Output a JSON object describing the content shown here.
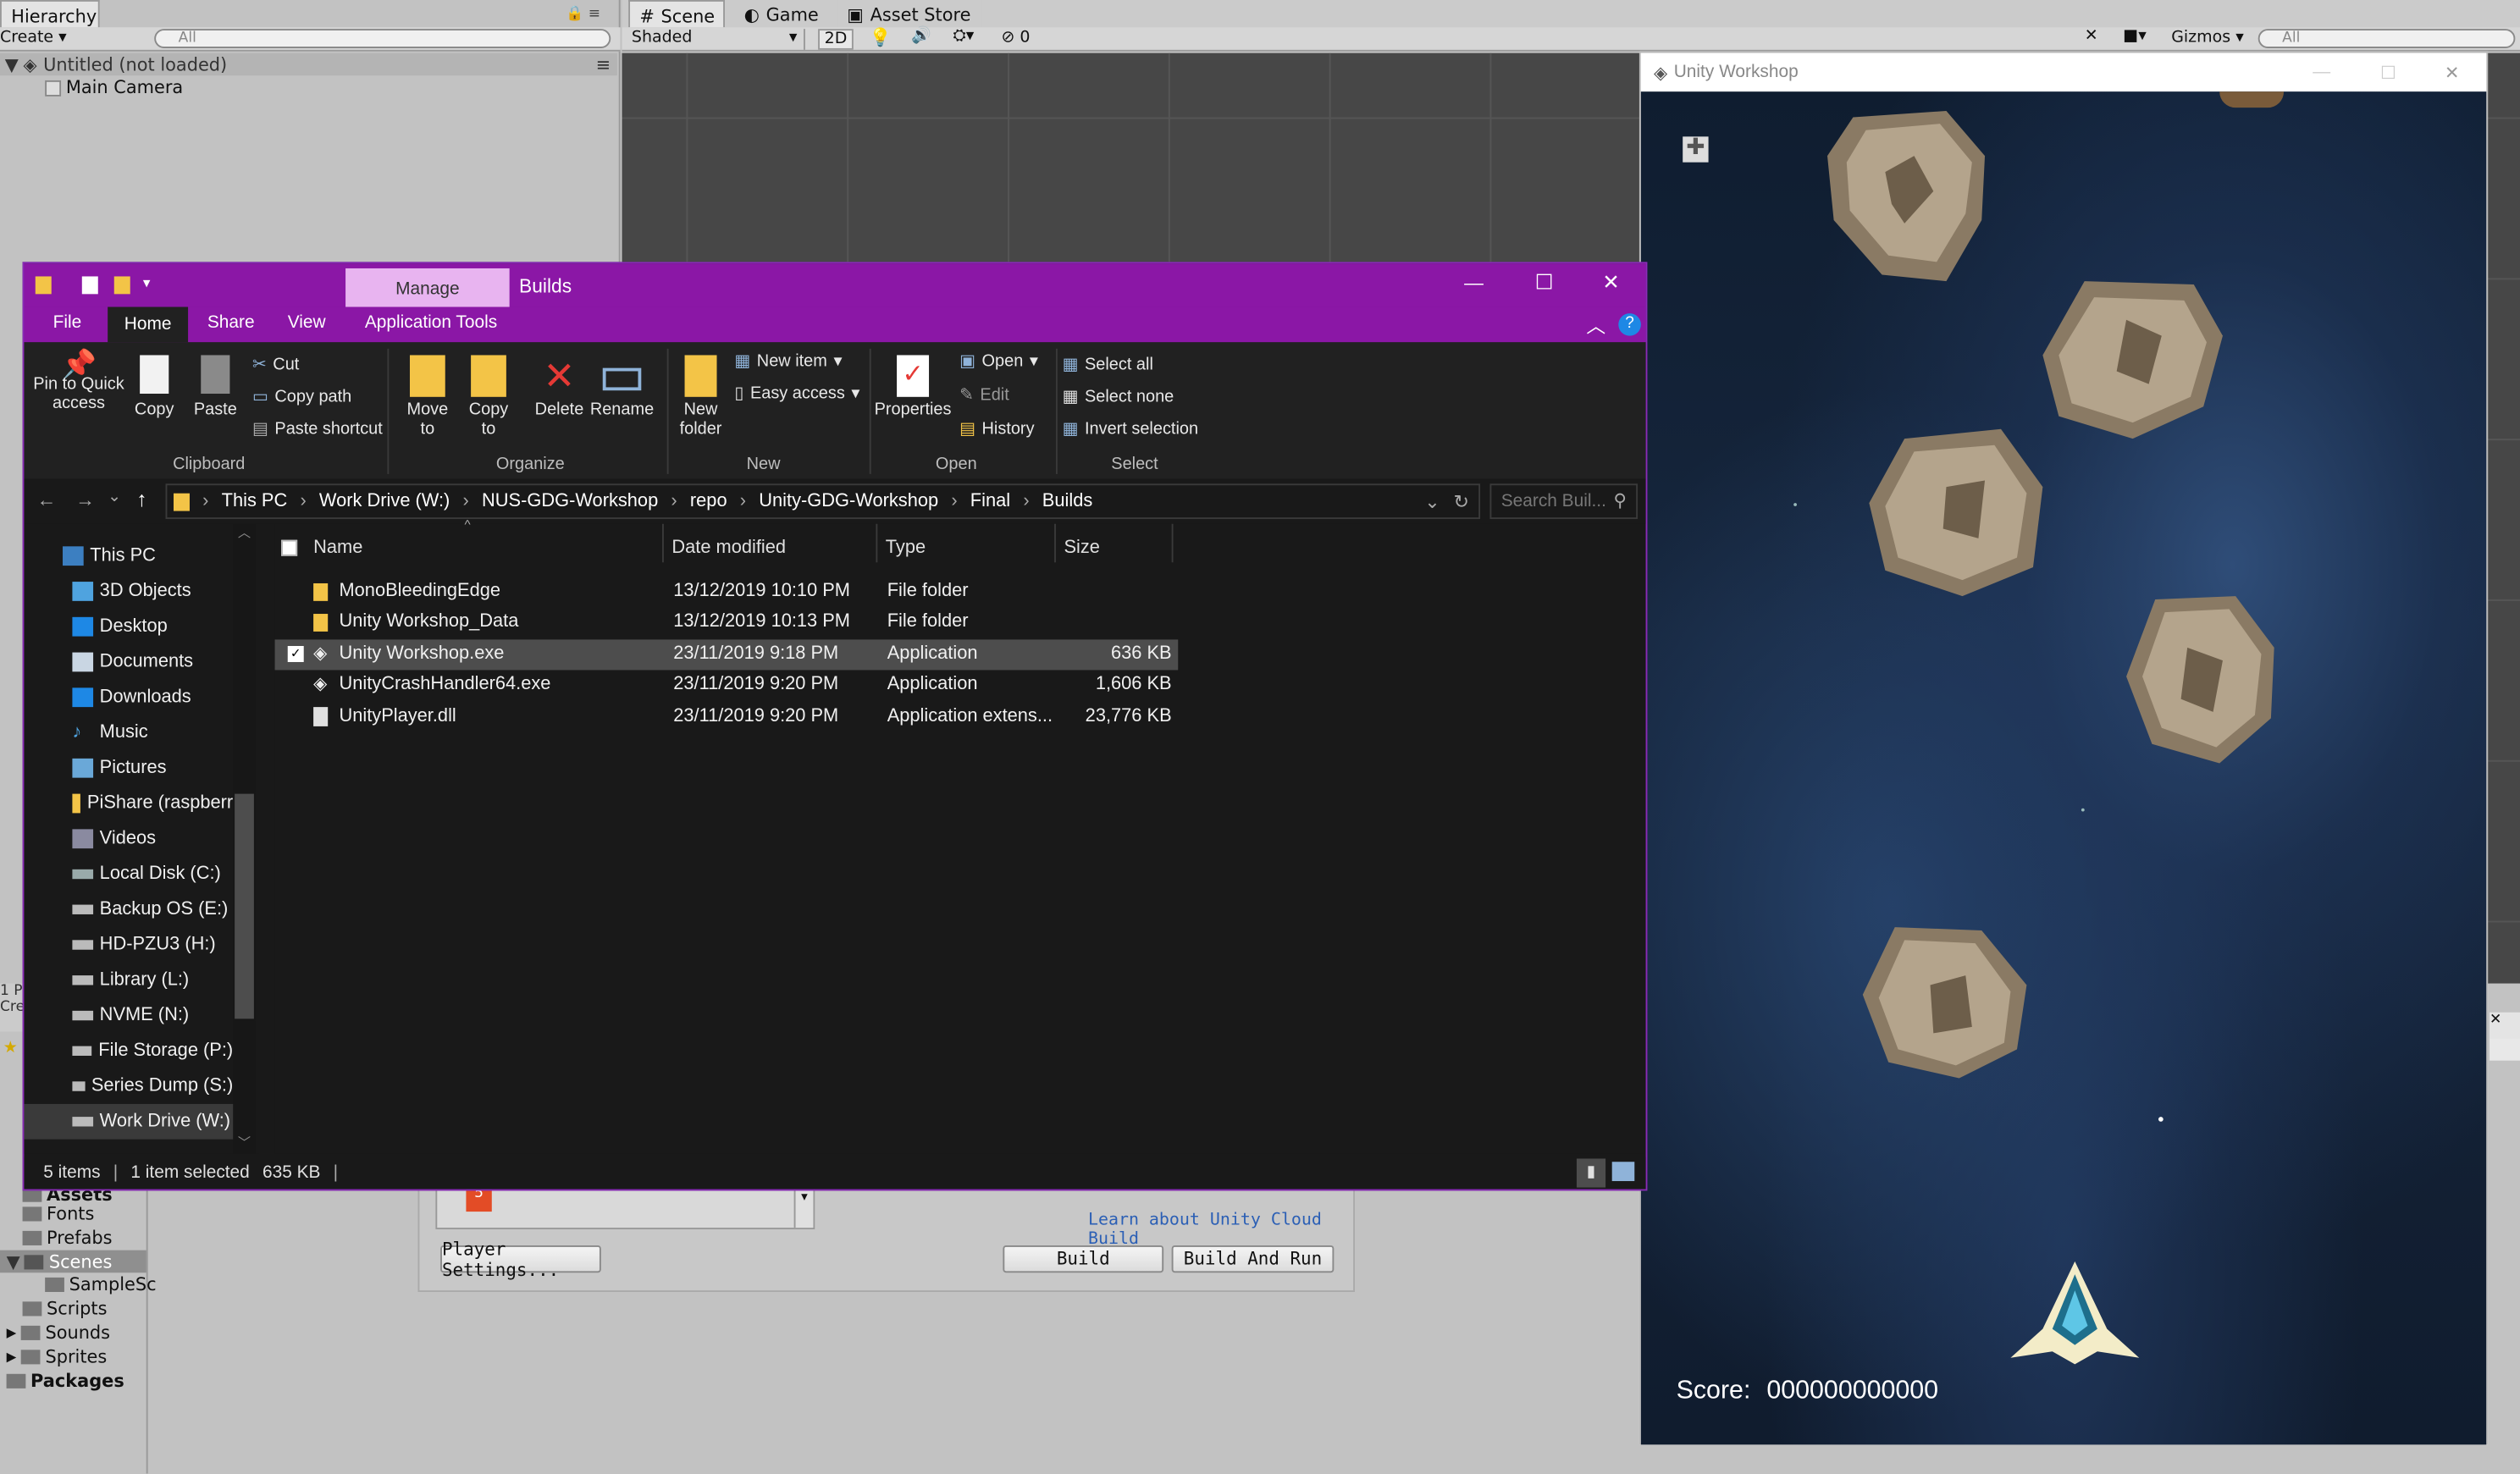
{
  "unity": {
    "hierarchy": {
      "tab": "Hierarchy",
      "create": "Create",
      "search_placeholder": "All",
      "scene": "Untitled (not loaded)",
      "items": [
        "Main Camera"
      ]
    },
    "scene_tabs": [
      "Scene",
      "Game",
      "Asset Store"
    ],
    "scene_toolbar": {
      "shading": "Shaded",
      "mode_2d": "2D",
      "effects_count": "0",
      "gizmos": "Gizmos",
      "search_placeholder": "All"
    },
    "project": {
      "folders": [
        "Assets",
        "Fonts",
        "Prefabs",
        "Scenes",
        "SampleSc",
        "Scripts",
        "Sounds",
        "Sprites",
        "Packages"
      ]
    },
    "build": {
      "cloud_link": "Learn about Unity Cloud Build",
      "player_settings": "Player Settings...",
      "build": "Build",
      "build_and_run": "Build And Run"
    }
  },
  "explorer": {
    "title": "Builds",
    "manage_tab": "Manage",
    "menu": [
      "File",
      "Home",
      "Share",
      "View",
      "Application Tools"
    ],
    "ribbon": {
      "clipboard": {
        "pin": "Pin to Quick access",
        "copy": "Copy",
        "paste": "Paste",
        "cut": "Cut",
        "copy_path": "Copy path",
        "paste_shortcut": "Paste shortcut",
        "label": "Clipboard"
      },
      "organize": {
        "move_to": "Move to",
        "copy_to": "Copy to",
        "delete": "Delete",
        "rename": "Rename",
        "label": "Organize"
      },
      "new": {
        "new_folder": "New folder",
        "new_item": "New item",
        "easy_access": "Easy access",
        "label": "New"
      },
      "open": {
        "properties": "Properties",
        "open": "Open",
        "edit": "Edit",
        "history": "History",
        "label": "Open"
      },
      "select": {
        "select_all": "Select all",
        "select_none": "Select none",
        "invert": "Invert selection",
        "label": "Select"
      }
    },
    "breadcrumb": [
      "This PC",
      "Work Drive (W:)",
      "NUS-GDG-Workshop",
      "repo",
      "Unity-GDG-Workshop",
      "Final",
      "Builds"
    ],
    "search_placeholder": "Search Buil...",
    "nav": [
      "This PC",
      "3D Objects",
      "Desktop",
      "Documents",
      "Downloads",
      "Music",
      "Pictures",
      "PiShare (raspberr",
      "Videos",
      "Local Disk (C:)",
      "Backup OS (E:)",
      "HD-PZU3 (H:)",
      "Library (L:)",
      "NVME (N:)",
      "File Storage (P:)",
      "Series Dump (S:)",
      "Work Drive (W:)"
    ],
    "columns": [
      "Name",
      "Date modified",
      "Type",
      "Size"
    ],
    "files": [
      {
        "name": "MonoBleedingEdge",
        "date": "13/12/2019 10:10 PM",
        "type": "File folder",
        "size": ""
      },
      {
        "name": "Unity Workshop_Data",
        "date": "13/12/2019 10:13 PM",
        "type": "File folder",
        "size": ""
      },
      {
        "name": "Unity Workshop.exe",
        "date": "23/11/2019 9:18 PM",
        "type": "Application",
        "size": "636 KB"
      },
      {
        "name": "UnityCrashHandler64.exe",
        "date": "23/11/2019 9:20 PM",
        "type": "Application",
        "size": "1,606 KB"
      },
      {
        "name": "UnityPlayer.dll",
        "date": "23/11/2019 9:20 PM",
        "type": "Application extens...",
        "size": "23,776 KB"
      }
    ],
    "status": {
      "items": "5 items",
      "selected": "1 item selected",
      "size": "635 KB"
    }
  },
  "game": {
    "title": "Unity Workshop",
    "score_label": "Score:",
    "score_value": "000000000000"
  },
  "colors": {
    "explorer_accent": "#8b17a6",
    "explorer_bg": "#191919",
    "unity_bg": "#c2c2c2",
    "selection": "#4d4d4d",
    "link": "#2b5fb5"
  }
}
